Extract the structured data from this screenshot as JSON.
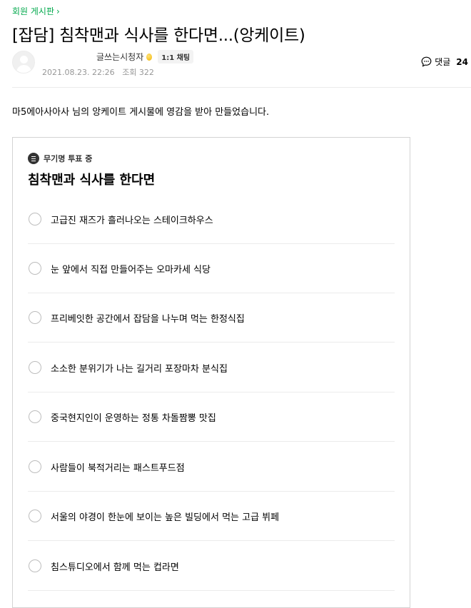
{
  "breadcrumb": {
    "board_label": "회원 게시판"
  },
  "post": {
    "title": "[잡담] 침착맨과 식사를 한다면...(앙케이트)",
    "author": "글쓰는시청자",
    "chat_label": "1:1 채팅",
    "date": "2021.08.23. 22:26",
    "views_label": "조회 322",
    "comment_label": "댓글",
    "comment_count": "24",
    "intro": "마5에아사아사 님의 앙케이트 게시물에 영감을 받아 만들었습니다."
  },
  "vote": {
    "status": "무기명 투표 중",
    "title": "침착맨과 식사를 한다면",
    "options": [
      {
        "label": "고급진 재즈가 흘러나오는 스테이크하우스"
      },
      {
        "label": "눈 앞에서 직접 만들어주는 오마카세 식당"
      },
      {
        "label": "프리베잇한 공간에서 잡담을 나누며 먹는 한정식집"
      },
      {
        "label": "소소한 분위기가 나는 길거리 포장마차 분식집"
      },
      {
        "label": "중국현지인이 운영하는 정통 차돌짬뽕 맛집"
      },
      {
        "label": "사람들이 북적거리는 패스트푸드점"
      },
      {
        "label": "서울의 야경이 한눈에 보이는 높은 빌딩에서 먹는 고급 뷔페"
      },
      {
        "label": "침스튜디오에서 함께 먹는 컵라면"
      }
    ]
  },
  "colors": {
    "accent": "#03a94d",
    "meta_text": "#979797",
    "border": "#d3d3d3"
  }
}
